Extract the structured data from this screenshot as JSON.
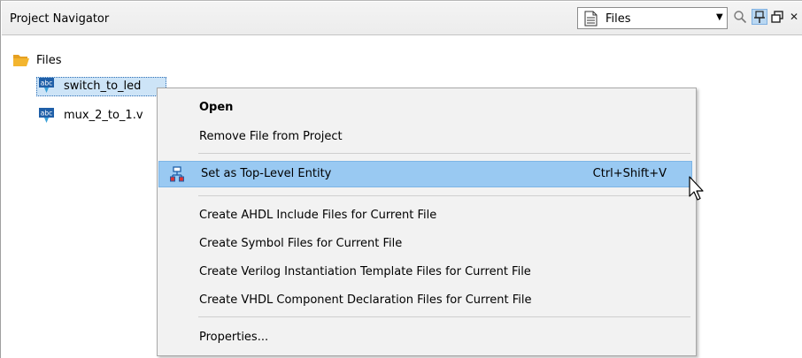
{
  "panel": {
    "title": "Project Navigator",
    "combo_value": "Files",
    "icons": [
      "document-icon",
      "chevron-down-icon",
      "search-icon",
      "pin-icon",
      "float-window-icon",
      "close-icon"
    ]
  },
  "tree": {
    "root_label": "Files",
    "files": [
      {
        "label": "switch_to_led",
        "icon": "verilog-file-icon",
        "selected": true
      },
      {
        "label": "mux_2_to_1.v",
        "icon": "verilog-file-icon",
        "selected": false
      }
    ],
    "file_icon_text": "abc"
  },
  "context_menu": {
    "items": [
      {
        "label": "Open",
        "bold": true
      },
      {
        "label": "Remove File from Project"
      },
      {
        "label": "Set as Top-Level Entity",
        "shortcut": "Ctrl+Shift+V",
        "highlighted": true,
        "icon": "hierarchy-icon"
      },
      {
        "label": "Create AHDL Include Files for Current File"
      },
      {
        "label": "Create Symbol Files for Current File"
      },
      {
        "label": "Create Verilog Instantiation Template Files for Current File"
      },
      {
        "label": "Create VHDL Component Declaration Files for Current File"
      },
      {
        "label": "Properties..."
      }
    ]
  },
  "colors": {
    "highlight": "#99c9f2",
    "selection": "#cde4f7",
    "folder": "#f3b52f",
    "file_icon": "#1f5fa8"
  }
}
